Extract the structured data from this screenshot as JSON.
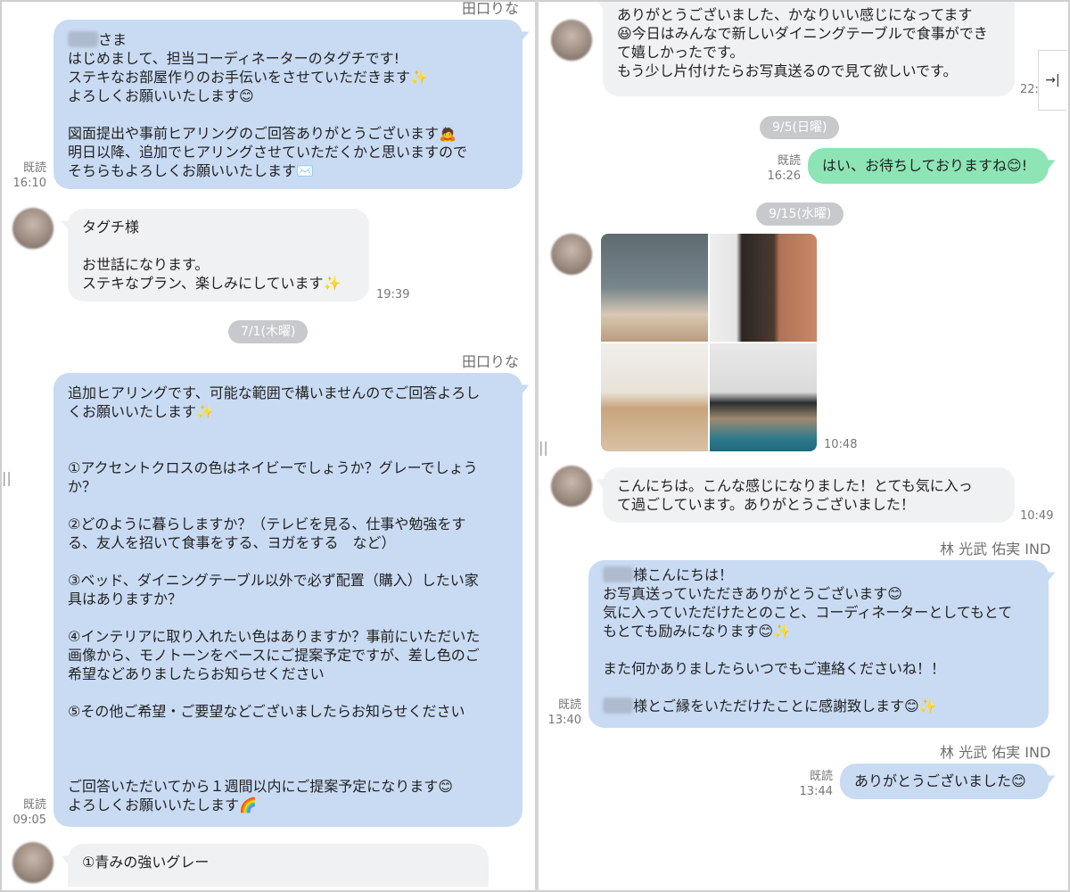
{
  "left": {
    "top_name": "田口りな",
    "msg1": {
      "salutation": "さま",
      "text": "はじめまして、担当コーディネーターのタグチです!\nステキなお部屋作りのお手伝いをさせていただきます✨\nよろしくお願いいたします😊\n\n図面提出や事前ヒアリングのご回答ありがとうございます🙇\n明日以降、追加でヒアリングさせていただくかと思いますので\nそちらもよろしくお願いいたします✉️",
      "read": "既読",
      "time": "16:10"
    },
    "msg2": {
      "text": "タグチ様\n\nお世話になります。\nステキなプラン、楽しみにしています✨",
      "time": "19:39"
    },
    "date1": "7/1(木曜)",
    "sender2": "田口りな",
    "msg3": {
      "text": "追加ヒアリングです、可能な範囲で構いませんのでご回答よろし\nくお願いいたします✨\n\n\n①アクセントクロスの色はネイビーでしょうか？グレーでしょう\nか？\n\n②どのように暮らしますか？（テレビを見る、仕事や勉強をす\nる、友人を招いて食事をする、ヨガをする　など）\n\n③ベッド、ダイニングテーブル以外で必ず配置（購入）したい家\n具はありますか？\n\n④インテリアに取り入れたい色はありますか？事前にいただいた\n画像から、モノトーンをベースにご提案予定ですが、差し色のご\n希望などありましたらお知らせください\n\n⑤その他ご希望・ご要望などございましたらお知らせください\n\n\n\nご回答いただいてから１週間以内にご提案予定になります😊\nよろしくお願いいたします🌈",
      "read": "既読",
      "time": "09:05"
    },
    "msg4": {
      "text": "①青みの強いグレー"
    }
  },
  "right": {
    "msg1": {
      "text": "ありがとうございました、かなりいい感じになってます\n😆今日はみんなで新しいダイニングテーブルで食事ができて嬉しかったです。\nもう少し片付けたらお写真送るので見て欲しいです。",
      "time": "22:"
    },
    "date1": "9/5(日曜)",
    "msg2": {
      "text": "はい、お待ちしておりますね😊!",
      "read": "既読",
      "time": "16:26"
    },
    "date2": "9/15(水曜)",
    "photos": {
      "time": "10:48"
    },
    "msg3": {
      "text": "こんにちは。こんな感じになりました！とても気に入っ\nて過ごしています。ありがとうございました！",
      "time": "10:49"
    },
    "sender1": "林 光武 佑実 IND",
    "msg4": {
      "line1": "様こんにちは！",
      "body": "お写真送っていただきありがとうございます😊\n気に入っていただけたとのこと、コーディネーターとしてもとて\nもとても励みになります😊✨\n\nまた何かありましたらいつでもご連絡くださいね！！\n",
      "line_last": "様とご縁をいただけたことに感謝致します😊✨",
      "read": "既読",
      "time": "13:40"
    },
    "sender2": "林 光武 佑実 IND",
    "msg5": {
      "text": "ありがとうございました😊",
      "read": "既読",
      "time": "13:44"
    },
    "collapse_glyph": "→|"
  },
  "colors": {
    "blue_bubble": "#c9dbf3",
    "gray_bubble": "#f0f1f3",
    "green_bubble": "#8de5b5"
  }
}
